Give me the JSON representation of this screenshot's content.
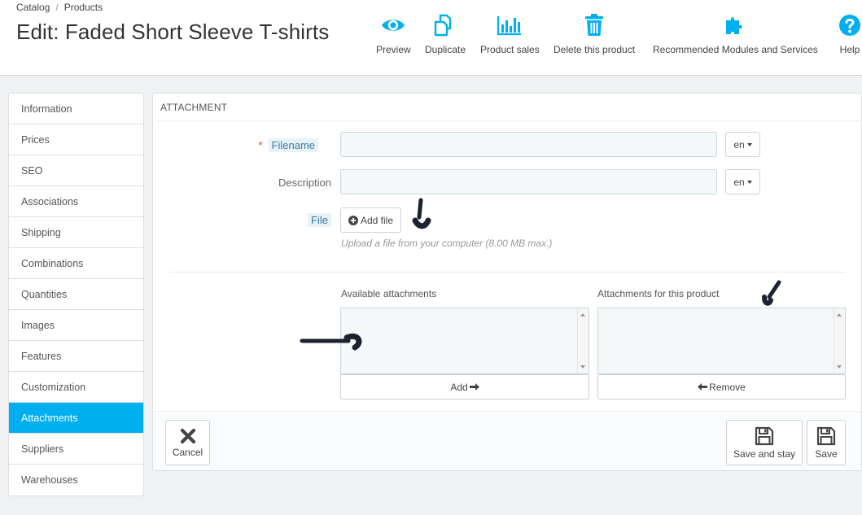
{
  "breadcrumb": {
    "parent": "Catalog",
    "separator": "/",
    "current": "Products"
  },
  "page_title": "Edit: Faded Short Sleeve T-shirts",
  "toolbar": [
    {
      "label": "Preview",
      "icon": "eye-icon"
    },
    {
      "label": "Duplicate",
      "icon": "copy-icon"
    },
    {
      "label": "Product sales",
      "icon": "bar-chart-icon"
    },
    {
      "label": "Delete this product",
      "icon": "trash-icon"
    },
    {
      "label": "Recommended Modules and Services",
      "icon": "puzzle-icon"
    },
    {
      "label": "Help",
      "icon": "help-icon"
    }
  ],
  "colors": {
    "accent": "#00aff0",
    "required": "#e3342f",
    "label_highlight_bg": "#e9f2f7",
    "label_highlight_text": "#3a7ca8"
  },
  "sidebar": {
    "items": [
      {
        "label": "Information"
      },
      {
        "label": "Prices"
      },
      {
        "label": "SEO"
      },
      {
        "label": "Associations"
      },
      {
        "label": "Shipping"
      },
      {
        "label": "Combinations"
      },
      {
        "label": "Quantities"
      },
      {
        "label": "Images"
      },
      {
        "label": "Features"
      },
      {
        "label": "Customization"
      },
      {
        "label": "Attachments",
        "active": true
      },
      {
        "label": "Suppliers"
      },
      {
        "label": "Warehouses"
      }
    ]
  },
  "panel": {
    "heading": "ATTACHMENT",
    "filename": {
      "required_mark": "*",
      "label": "Filename",
      "value": "",
      "lang": "en"
    },
    "description": {
      "label": "Description",
      "value": "",
      "lang": "en"
    },
    "file": {
      "label": "File",
      "button": "Add file",
      "help": "Upload a file from your computer (8.00 MB max.)"
    },
    "available": {
      "label": "Available attachments",
      "button": "Add"
    },
    "assigned": {
      "label": "Attachments for this product",
      "button": "Remove"
    }
  },
  "footer": {
    "cancel": "Cancel",
    "save_and_stay": "Save and stay",
    "save": "Save"
  }
}
